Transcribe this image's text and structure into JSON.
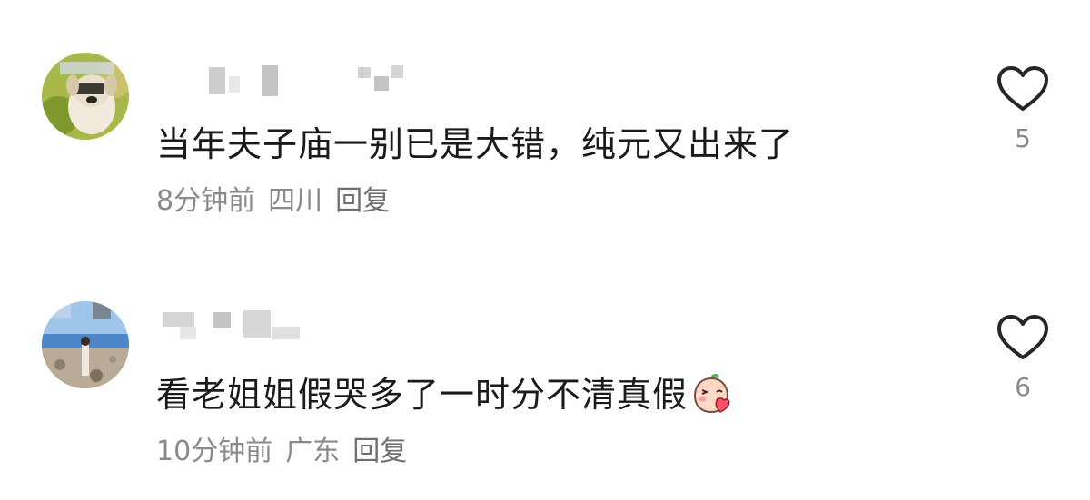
{
  "comments": [
    {
      "text": "当年夫子庙一别已是大错，纯元又出来了",
      "time": "8分钟前",
      "location": "四川",
      "reply_label": "回复",
      "likes": "5",
      "avatar_icon": "dog-photo-avatar",
      "like_icon": "heart-outline-icon"
    },
    {
      "text": "看老姐姐假哭多了一时分不清真假",
      "time": "10分钟前",
      "location": "广东",
      "reply_label": "回复",
      "likes": "6",
      "avatar_icon": "beach-photo-avatar",
      "like_icon": "heart-outline-icon",
      "emoji_icon": "peach-shy-emoji"
    }
  ],
  "colors": {
    "text": "#1a1a1a",
    "meta": "#8a8a8a",
    "background": "#ffffff"
  }
}
